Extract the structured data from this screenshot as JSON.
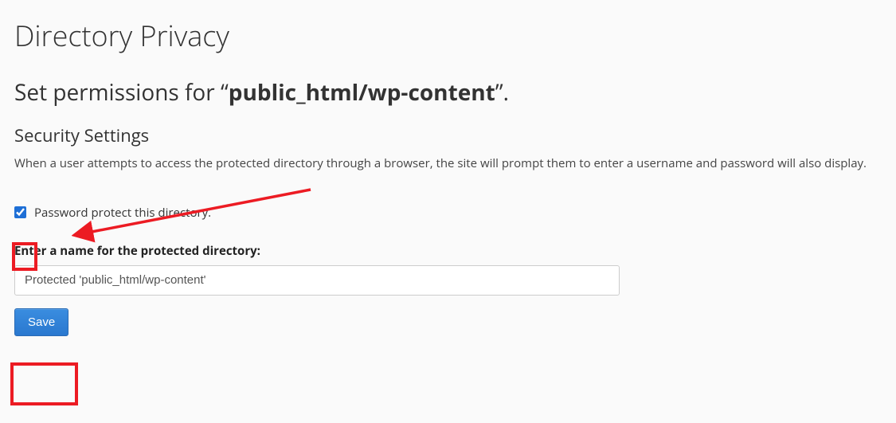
{
  "page": {
    "title": "Directory Privacy"
  },
  "permissions": {
    "prefix": "Set permissions for “",
    "path": "public_html/wp-content",
    "suffix": "”."
  },
  "security": {
    "heading": "Security Settings",
    "description": "When a user attempts to access the protected directory through a browser, the site will prompt them to enter a username and password will also display.",
    "checkbox_label": "Password protect this directory."
  },
  "name_field": {
    "label": "Enter a name for the protected directory:",
    "value": "Protected 'public_html/wp-content'"
  },
  "buttons": {
    "save": "Save"
  }
}
